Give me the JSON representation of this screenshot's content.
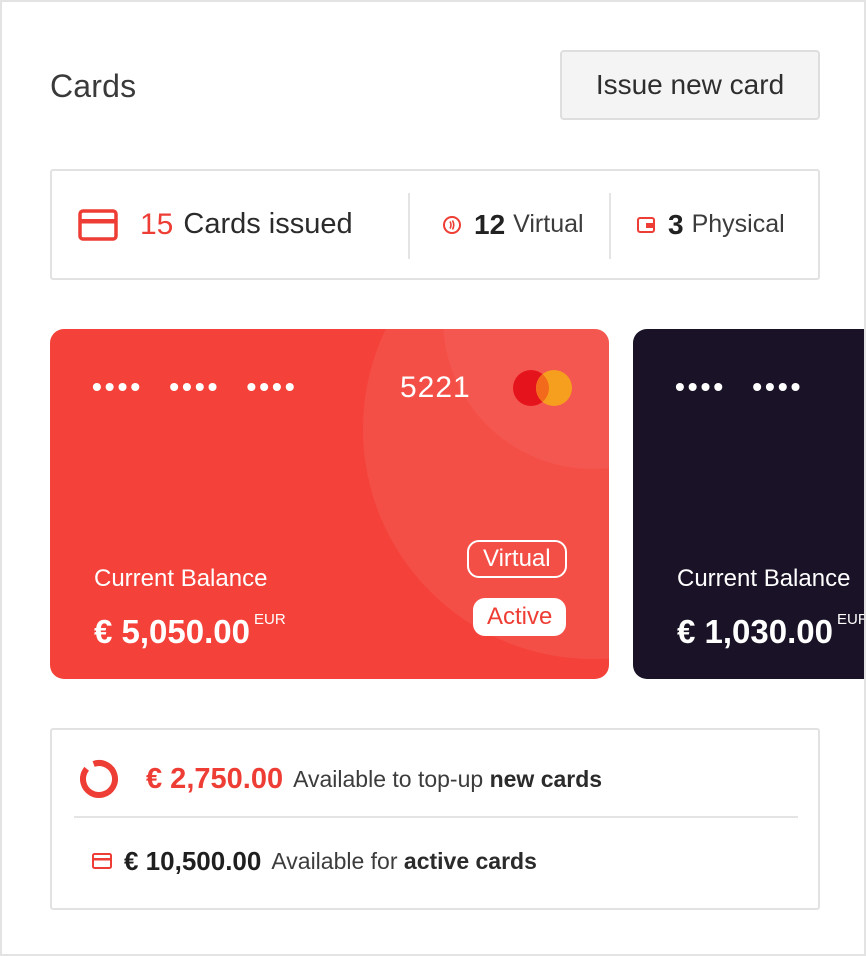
{
  "header": {
    "title": "Cards",
    "issue_button": "Issue new card"
  },
  "stats": {
    "issued_count": "15",
    "issued_label": "Cards issued",
    "virtual_count": "12",
    "virtual_label": "Virtual",
    "physical_count": "3",
    "physical_label": "Physical"
  },
  "cards": [
    {
      "masked_groups": [
        "••••",
        "••••",
        "••••"
      ],
      "last4": "5221",
      "balance_label": "Current Balance",
      "balance": "€ 5,050.00",
      "currency": "EUR",
      "type_badge": "Virtual",
      "status_badge": "Active",
      "brand_icon": "mastercard-logo",
      "color": "#f4423a"
    },
    {
      "masked_groups": [
        "••••",
        "••••"
      ],
      "balance_label": "Current Balance",
      "balance": "€ 1,030.00",
      "currency": "EUR",
      "color": "#1a1226"
    }
  ],
  "availability": {
    "topup_amount": "€ 2,750.00",
    "topup_text": "Available to top-up ",
    "topup_bold": "new cards",
    "active_amount": "€ 10,500.00",
    "active_text": "Available for ",
    "active_bold": "active cards"
  },
  "colors": {
    "accent": "#ee3d34",
    "card_red": "#f4423a",
    "card_dark": "#1a1226"
  }
}
